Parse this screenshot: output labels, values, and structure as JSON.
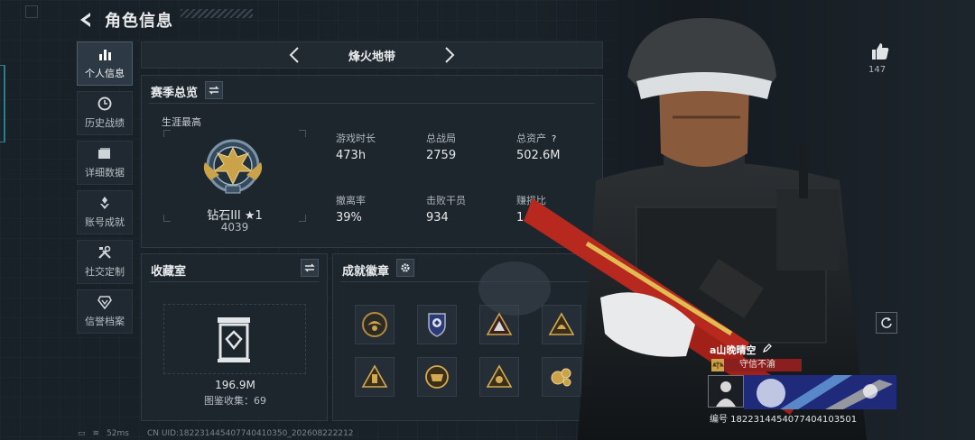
{
  "header": {
    "title": "角色信息"
  },
  "sidebar": {
    "items": [
      {
        "label": "个人信息",
        "icon": "bar-chart-icon"
      },
      {
        "label": "历史战绩",
        "icon": "clock-icon"
      },
      {
        "label": "详细数据",
        "icon": "folder-icon"
      },
      {
        "label": "账号成就",
        "icon": "achievement-icon"
      },
      {
        "label": "社交定制",
        "icon": "tools-icon"
      },
      {
        "label": "信誉档案",
        "icon": "shield-icon"
      }
    ]
  },
  "mode": {
    "title": "烽火地带"
  },
  "season": {
    "title": "赛季总览",
    "career_label": "生涯最高",
    "rank_name": "钻石III ★1",
    "rank_score": "4039",
    "stats": [
      {
        "label": "游戏时长",
        "value": "473h"
      },
      {
        "label": "总战局",
        "value": "2759"
      },
      {
        "label": "总资产",
        "value": "502.6M"
      },
      {
        "label": "撤离率",
        "value": "39%"
      },
      {
        "label": "击败干员",
        "value": "934"
      },
      {
        "label": "赚损比",
        "value": "1.2M"
      }
    ],
    "help": "?"
  },
  "collection": {
    "title": "收藏室",
    "value": "196.9M",
    "count": "图鉴收集：69"
  },
  "achievements": {
    "title": "成就徽章",
    "badges": [
      "eagle-badge-icon",
      "police-badge-icon",
      "triangle-badge-icon",
      "triangle-gold-badge-icon",
      "triangle-gold-badge-icon",
      "crest-badge-icon",
      "triangle-badge-icon",
      "gear-gold-badge-icon"
    ]
  },
  "character": {
    "likes": "147",
    "player_name": "a山晚晴空",
    "title_tag": "守信不渝",
    "card_id": "编号 1822314454077404103501"
  },
  "footer": {
    "ping": "52ms",
    "uid": "CN UID:18223144540774041035­0_202608222212"
  },
  "colors": {
    "accent": "#8b1f1f",
    "panel": "#1e262d",
    "gold": "#c9a24a"
  }
}
